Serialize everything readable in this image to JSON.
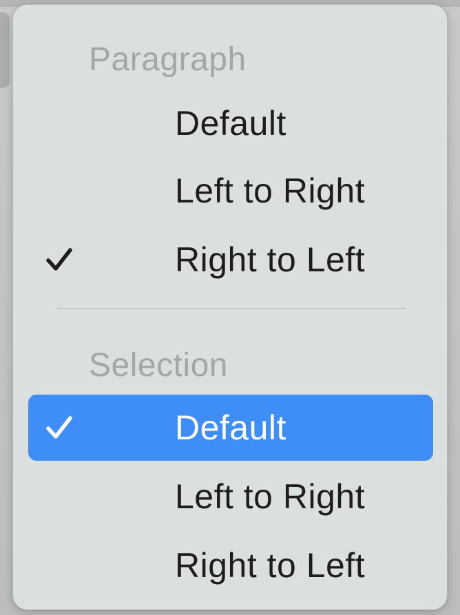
{
  "menu": {
    "sections": [
      {
        "header": "Paragraph",
        "items": [
          {
            "label": "Default",
            "checked": false,
            "highlighted": false
          },
          {
            "label": "Left to Right",
            "checked": false,
            "highlighted": false
          },
          {
            "label": "Right to Left",
            "checked": true,
            "highlighted": false
          }
        ]
      },
      {
        "header": "Selection",
        "items": [
          {
            "label": "Default",
            "checked": true,
            "highlighted": true
          },
          {
            "label": "Left to Right",
            "checked": false,
            "highlighted": false
          },
          {
            "label": "Right to Left",
            "checked": false,
            "highlighted": false
          }
        ]
      }
    ],
    "check_icon": "checkmark-icon",
    "colors": {
      "menu_background": "#dcdfdf",
      "highlight": "#3f8ef7",
      "header_text": "#a4a7a7",
      "item_text": "#1d1d1d",
      "highlight_text": "#ffffff"
    }
  }
}
